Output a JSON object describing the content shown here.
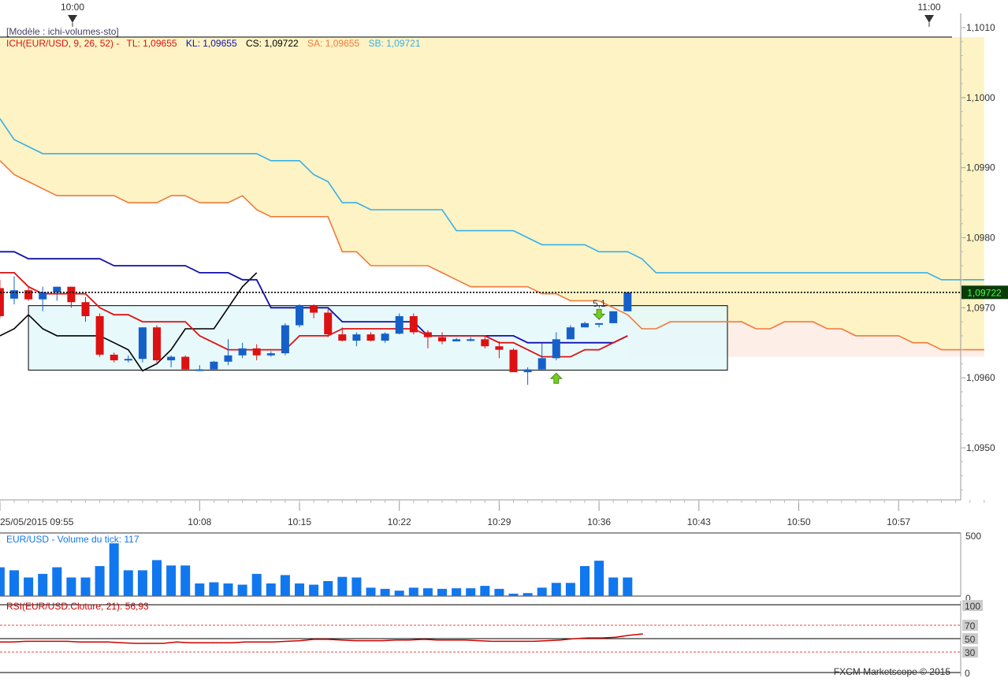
{
  "top_time_markers": [
    "10:00",
    "11:00"
  ],
  "header": {
    "template": "[Modèle : ichi-volumes-sto]",
    "ich_prefix": "ICH(EUR/USD, 9, 26, 52) -",
    "tl": "TL: 1,09655",
    "kl": "KL: 1,09655",
    "cs": "CS: 1,09722",
    "sa": "SA: 1,09655",
    "sb": "SB: 1,09721"
  },
  "price_axis": {
    "ticks": [
      "1,1010",
      "1,1000",
      "1,0990",
      "1,0980",
      "1,0970",
      "1,0960",
      "1,0950"
    ],
    "current_price": "1,09722"
  },
  "time_axis": {
    "first_label": "25/05/2015 09:55",
    "labels": [
      "10:08",
      "10:15",
      "10:22",
      "10:29",
      "10:36",
      "10:43",
      "10:50",
      "10:57"
    ]
  },
  "signal_label": "5,1",
  "volume_panel": {
    "title": "EUR/USD - Volume du tick: 117",
    "axis_top": "500",
    "axis_bottom": "0"
  },
  "rsi_panel": {
    "title": "RSI(EUR/USD.Cloture, 21): 56,93",
    "levels": [
      "100",
      "70",
      "50",
      "30",
      "0"
    ]
  },
  "footer": "FXCM Marketscope © 2015",
  "colors": {
    "bull": "#1560c8",
    "bear": "#dd1111",
    "tenkan": "#dd1111",
    "kijun": "#1010aa",
    "chikou": "#000000",
    "senkou_a": "#f07a3c",
    "senkou_b": "#38b0e8",
    "cloud_bull": "#fdf3c4",
    "cloud_bear": "#fdefe8",
    "range_box": "#e4f8fc",
    "volume": "#1177ee",
    "rsi": "#cc0000",
    "current_price_bg": "#0a3a0a",
    "current_price_text": "#44ff44"
  },
  "chart_data": [
    {
      "type": "candlestick",
      "title": "ICH(EUR/USD, 9, 26, 52)",
      "x_unit": "minutes after 09:55",
      "ylim": [
        1.0943,
        1.1012
      ],
      "candles": [
        {
          "x": -1,
          "o": 1.09728,
          "h": 1.0974,
          "l": 1.09685,
          "c": 1.09688
        },
        {
          "x": 0,
          "o": 1.09713,
          "h": 1.09745,
          "l": 1.09705,
          "c": 1.09725
        },
        {
          "x": 1,
          "o": 1.09725,
          "h": 1.0973,
          "l": 1.0971,
          "c": 1.09712
        },
        {
          "x": 2,
          "o": 1.09712,
          "h": 1.0973,
          "l": 1.09695,
          "c": 1.09722
        },
        {
          "x": 3,
          "o": 1.09722,
          "h": 1.0973,
          "l": 1.0971,
          "c": 1.0973
        },
        {
          "x": 4,
          "o": 1.0973,
          "h": 1.0973,
          "l": 1.097,
          "c": 1.09708
        },
        {
          "x": 5,
          "o": 1.09708,
          "h": 1.09715,
          "l": 1.0968,
          "c": 1.09688
        },
        {
          "x": 6,
          "o": 1.09688,
          "h": 1.09692,
          "l": 1.0963,
          "c": 1.09633
        },
        {
          "x": 7,
          "o": 1.09633,
          "h": 1.09636,
          "l": 1.09622,
          "c": 1.09625
        },
        {
          "x": 8,
          "o": 1.09625,
          "h": 1.09632,
          "l": 1.09622,
          "c": 1.09627
        },
        {
          "x": 9,
          "o": 1.09627,
          "h": 1.09672,
          "l": 1.09622,
          "c": 1.09672
        },
        {
          "x": 10,
          "o": 1.09672,
          "h": 1.09675,
          "l": 1.09622,
          "c": 1.09625
        },
        {
          "x": 11,
          "o": 1.09625,
          "h": 1.09632,
          "l": 1.09615,
          "c": 1.0963
        },
        {
          "x": 12,
          "o": 1.0963,
          "h": 1.09632,
          "l": 1.09612,
          "c": 1.09612
        },
        {
          "x": 13,
          "o": 1.09612,
          "h": 1.09618,
          "l": 1.0961,
          "c": 1.09612
        },
        {
          "x": 14,
          "o": 1.09612,
          "h": 1.09624,
          "l": 1.09612,
          "c": 1.09623
        },
        {
          "x": 15,
          "o": 1.09623,
          "h": 1.09655,
          "l": 1.09618,
          "c": 1.09632
        },
        {
          "x": 16,
          "o": 1.09632,
          "h": 1.0965,
          "l": 1.09628,
          "c": 1.09642
        },
        {
          "x": 17,
          "o": 1.09642,
          "h": 1.09648,
          "l": 1.09625,
          "c": 1.09632
        },
        {
          "x": 18,
          "o": 1.09632,
          "h": 1.09638,
          "l": 1.0963,
          "c": 1.09635
        },
        {
          "x": 19,
          "o": 1.09635,
          "h": 1.09678,
          "l": 1.09632,
          "c": 1.09675
        },
        {
          "x": 20,
          "o": 1.09675,
          "h": 1.09705,
          "l": 1.09672,
          "c": 1.09703
        },
        {
          "x": 21,
          "o": 1.09703,
          "h": 1.09705,
          "l": 1.09685,
          "c": 1.09693
        },
        {
          "x": 22,
          "o": 1.09693,
          "h": 1.09698,
          "l": 1.09658,
          "c": 1.09662
        },
        {
          "x": 23,
          "o": 1.09662,
          "h": 1.09672,
          "l": 1.09652,
          "c": 1.09653
        },
        {
          "x": 24,
          "o": 1.09653,
          "h": 1.09665,
          "l": 1.09645,
          "c": 1.09662
        },
        {
          "x": 25,
          "o": 1.09662,
          "h": 1.09665,
          "l": 1.09652,
          "c": 1.09653
        },
        {
          "x": 26,
          "o": 1.09653,
          "h": 1.09665,
          "l": 1.0965,
          "c": 1.09663
        },
        {
          "x": 27,
          "o": 1.09663,
          "h": 1.09692,
          "l": 1.09662,
          "c": 1.09688
        },
        {
          "x": 28,
          "o": 1.09688,
          "h": 1.09692,
          "l": 1.09662,
          "c": 1.09665
        },
        {
          "x": 29,
          "o": 1.09665,
          "h": 1.09668,
          "l": 1.09642,
          "c": 1.09658
        },
        {
          "x": 30,
          "o": 1.09658,
          "h": 1.09665,
          "l": 1.09648,
          "c": 1.09652
        },
        {
          "x": 31,
          "o": 1.09652,
          "h": 1.09657,
          "l": 1.09652,
          "c": 1.09655
        },
        {
          "x": 32,
          "o": 1.09655,
          "h": 1.09658,
          "l": 1.09652,
          "c": 1.09655
        },
        {
          "x": 33,
          "o": 1.09655,
          "h": 1.0966,
          "l": 1.09642,
          "c": 1.09645
        },
        {
          "x": 34,
          "o": 1.09645,
          "h": 1.09652,
          "l": 1.09628,
          "c": 1.0964
        },
        {
          "x": 35,
          "o": 1.0964,
          "h": 1.09642,
          "l": 1.09608,
          "c": 1.09608
        },
        {
          "x": 36,
          "o": 1.09608,
          "h": 1.09615,
          "l": 1.0959,
          "c": 1.09612
        },
        {
          "x": 37,
          "o": 1.09612,
          "h": 1.0965,
          "l": 1.09612,
          "c": 1.09628
        },
        {
          "x": 38,
          "o": 1.09628,
          "h": 1.09665,
          "l": 1.09625,
          "c": 1.09655
        },
        {
          "x": 39,
          "o": 1.09655,
          "h": 1.09675,
          "l": 1.09655,
          "c": 1.09672
        },
        {
          "x": 40,
          "o": 1.09672,
          "h": 1.0968,
          "l": 1.09672,
          "c": 1.09678
        },
        {
          "x": 41,
          "o": 1.09676,
          "h": 1.09678,
          "l": 1.09672,
          "c": 1.09678
        },
        {
          "x": 42,
          "o": 1.09678,
          "h": 1.09695,
          "l": 1.09678,
          "c": 1.09695
        },
        {
          "x": 43,
          "o": 1.09695,
          "h": 1.09722,
          "l": 1.09695,
          "c": 1.09722
        }
      ],
      "tenkan": {
        "name": "TL",
        "x": [
          -1,
          0,
          1,
          2,
          3,
          4,
          5,
          6,
          7,
          8,
          9,
          10,
          11,
          12,
          13,
          14,
          15,
          16,
          17,
          18,
          19,
          20,
          21,
          22,
          23,
          24,
          25,
          26,
          27,
          28,
          29,
          30,
          31,
          32,
          33,
          34,
          35,
          36,
          37,
          38,
          39,
          40,
          41,
          42,
          43
        ],
        "y": [
          1.0975,
          1.0975,
          1.0973,
          1.0972,
          1.0972,
          1.0972,
          1.0972,
          1.097,
          1.0969,
          1.0969,
          1.0968,
          1.0968,
          1.0968,
          1.0968,
          1.0966,
          1.0965,
          1.0964,
          1.0964,
          1.0964,
          1.0964,
          1.0964,
          1.0966,
          1.0966,
          1.0966,
          1.0967,
          1.0967,
          1.0967,
          1.0967,
          1.0967,
          1.0967,
          1.0966,
          1.0966,
          1.0966,
          1.0966,
          1.0966,
          1.0965,
          1.0965,
          1.0964,
          1.0963,
          1.0963,
          1.0963,
          1.0964,
          1.0964,
          1.0965,
          1.0966
        ]
      },
      "kijun": {
        "name": "KL",
        "x": [
          -1,
          0,
          1,
          2,
          3,
          4,
          5,
          6,
          7,
          8,
          9,
          10,
          11,
          12,
          13,
          14,
          15,
          16,
          17,
          18,
          19,
          20,
          21,
          22,
          23,
          24,
          25,
          26,
          27,
          28,
          29,
          30,
          31,
          32,
          33,
          34,
          35,
          36,
          37,
          38,
          39,
          40,
          41,
          42,
          43
        ],
        "y": [
          1.0978,
          1.0978,
          1.0977,
          1.0977,
          1.0977,
          1.0977,
          1.0977,
          1.0977,
          1.0976,
          1.0976,
          1.0976,
          1.0976,
          1.0976,
          1.0976,
          1.0975,
          1.0975,
          1.0975,
          1.0974,
          1.0974,
          1.097,
          1.097,
          1.097,
          1.097,
          1.097,
          1.0968,
          1.0968,
          1.0968,
          1.0968,
          1.0968,
          1.0968,
          1.0966,
          1.0966,
          1.0966,
          1.0966,
          1.0966,
          1.0966,
          1.0966,
          1.0965,
          1.0965,
          1.0965,
          1.0965,
          1.0965,
          1.0965,
          1.0965,
          1.0966
        ]
      },
      "chikou": {
        "name": "CS",
        "x": [
          -1,
          0,
          1,
          2,
          3,
          4,
          5,
          6,
          7,
          8,
          9,
          10,
          11,
          12,
          13,
          14,
          15,
          16,
          17
        ],
        "y": [
          1.0966,
          1.0967,
          1.0969,
          1.0967,
          1.0966,
          1.0966,
          1.0966,
          1.0966,
          1.0965,
          1.0964,
          1.0961,
          1.0962,
          1.0964,
          1.0967,
          1.0967,
          1.0967,
          1.097,
          1.0973,
          1.0975
        ]
      },
      "senkou_a": {
        "name": "SA",
        "x": [
          -1,
          0,
          1,
          2,
          3,
          4,
          5,
          6,
          7,
          8,
          9,
          10,
          11,
          12,
          13,
          14,
          15,
          16,
          17,
          18,
          19,
          20,
          21,
          22,
          23,
          24,
          25,
          26,
          27,
          28,
          29,
          30,
          31,
          32,
          33,
          34,
          35,
          36,
          37,
          38,
          39,
          40,
          41,
          42,
          43,
          44,
          45,
          46,
          47,
          48,
          49,
          50,
          51,
          52,
          53,
          54,
          55,
          56,
          57,
          58,
          59,
          60,
          61,
          62,
          63,
          64,
          65,
          66,
          67,
          68
        ],
        "y": [
          1.0991,
          1.0989,
          1.0988,
          1.0987,
          1.0986,
          1.0986,
          1.0986,
          1.0986,
          1.0986,
          1.0985,
          1.0985,
          1.0985,
          1.0986,
          1.0986,
          1.0985,
          1.0985,
          1.0985,
          1.0986,
          1.0984,
          1.0983,
          1.0983,
          1.0983,
          1.0983,
          1.0983,
          1.0978,
          1.0978,
          1.0976,
          1.0976,
          1.0976,
          1.0976,
          1.0976,
          1.0975,
          1.0974,
          1.0973,
          1.0973,
          1.0973,
          1.0973,
          1.0973,
          1.0972,
          1.0972,
          1.0971,
          1.0971,
          1.0971,
          1.097,
          1.0969,
          1.0967,
          1.0967,
          1.0968,
          1.0968,
          1.0968,
          1.0968,
          1.0968,
          1.0968,
          1.0967,
          1.0967,
          1.0968,
          1.0968,
          1.0968,
          1.0967,
          1.0967,
          1.0966,
          1.0966,
          1.0966,
          1.0966,
          1.0965,
          1.0965,
          1.0964,
          1.0964,
          1.0964,
          1.0964
        ]
      },
      "senkou_b": {
        "name": "SB",
        "x": [
          -1,
          0,
          1,
          2,
          3,
          4,
          5,
          6,
          7,
          8,
          9,
          10,
          11,
          12,
          13,
          14,
          15,
          16,
          17,
          18,
          19,
          20,
          21,
          22,
          23,
          24,
          25,
          26,
          27,
          28,
          29,
          30,
          31,
          32,
          33,
          34,
          35,
          36,
          37,
          38,
          39,
          40,
          41,
          42,
          43,
          44,
          45,
          46,
          47,
          48,
          49,
          50,
          51,
          52,
          53,
          54,
          55,
          56,
          57,
          58,
          59,
          60,
          61,
          62,
          63,
          64,
          65,
          66,
          67,
          68
        ],
        "y": [
          1.0997,
          1.0994,
          1.0993,
          1.0992,
          1.0992,
          1.0992,
          1.0992,
          1.0992,
          1.0992,
          1.0992,
          1.0992,
          1.0992,
          1.0992,
          1.0992,
          1.0992,
          1.0992,
          1.0992,
          1.0992,
          1.0992,
          1.0991,
          1.0991,
          1.0991,
          1.0989,
          1.0988,
          1.0985,
          1.0985,
          1.0984,
          1.0984,
          1.0984,
          1.0984,
          1.0984,
          1.0984,
          1.0981,
          1.0981,
          1.0981,
          1.0981,
          1.0981,
          1.098,
          1.0979,
          1.0979,
          1.0979,
          1.0979,
          1.0978,
          1.0978,
          1.0978,
          1.0977,
          1.0975,
          1.0975,
          1.0975,
          1.0975,
          1.0975,
          1.0975,
          1.0975,
          1.0975,
          1.0975,
          1.0975,
          1.0975,
          1.0975,
          1.0975,
          1.0975,
          1.0975,
          1.0975,
          1.0975,
          1.0975,
          1.0975,
          1.0975,
          1.0974,
          1.0974,
          1.0974,
          1.0974
        ]
      },
      "range_box": {
        "x": [
          1,
          50
        ],
        "y": [
          1.09611,
          1.09703
        ]
      },
      "markers": [
        {
          "kind": "sell-arrow",
          "x": 41,
          "y": 1.0969
        },
        {
          "kind": "buy-arrow",
          "x": 38,
          "y": 1.096
        }
      ]
    },
    {
      "type": "bar",
      "title": "EUR/USD - Volume du tick: 117",
      "x": [
        -1,
        0,
        1,
        2,
        3,
        4,
        5,
        6,
        7,
        8,
        9,
        10,
        11,
        12,
        13,
        14,
        15,
        16,
        17,
        18,
        19,
        20,
        21,
        22,
        23,
        24,
        25,
        26,
        27,
        28,
        29,
        30,
        31,
        32,
        33,
        34,
        35,
        36,
        37,
        38,
        39,
        40,
        41,
        42,
        43
      ],
      "values": [
        240,
        215,
        155,
        185,
        240,
        155,
        155,
        250,
        440,
        215,
        215,
        300,
        255,
        255,
        105,
        115,
        105,
        95,
        185,
        105,
        175,
        105,
        95,
        125,
        160,
        155,
        70,
        60,
        45,
        70,
        65,
        60,
        65,
        65,
        85,
        60,
        20,
        25,
        70,
        110,
        110,
        250,
        295,
        155,
        155,
        155,
        45,
        50,
        105
      ],
      "ylim": [
        0,
        500
      ]
    },
    {
      "type": "line",
      "title": "RSI(EUR/USD.Cloture, 21): 56,93",
      "x": [
        -1,
        0,
        1,
        2,
        3,
        4,
        5,
        6,
        7,
        8,
        9,
        10,
        11,
        12,
        13,
        14,
        15,
        16,
        17,
        18,
        19,
        20,
        21,
        22,
        23,
        24,
        25,
        26,
        27,
        28,
        29,
        30,
        31,
        32,
        33,
        34,
        35,
        36,
        37,
        38,
        39,
        40,
        41,
        42,
        43
      ],
      "values": [
        45,
        45,
        46,
        46,
        46,
        46,
        45,
        45,
        45,
        44,
        43,
        43,
        43,
        45,
        44,
        44,
        44,
        44,
        45,
        45,
        45,
        46,
        47,
        49,
        49,
        48,
        47,
        47,
        47,
        48,
        48,
        49,
        48,
        48,
        48,
        47,
        46,
        46,
        46,
        46,
        47,
        48,
        50,
        51,
        51,
        52,
        55,
        57
      ],
      "ylim": [
        0,
        100
      ],
      "levels": [
        30,
        50,
        70
      ]
    }
  ]
}
